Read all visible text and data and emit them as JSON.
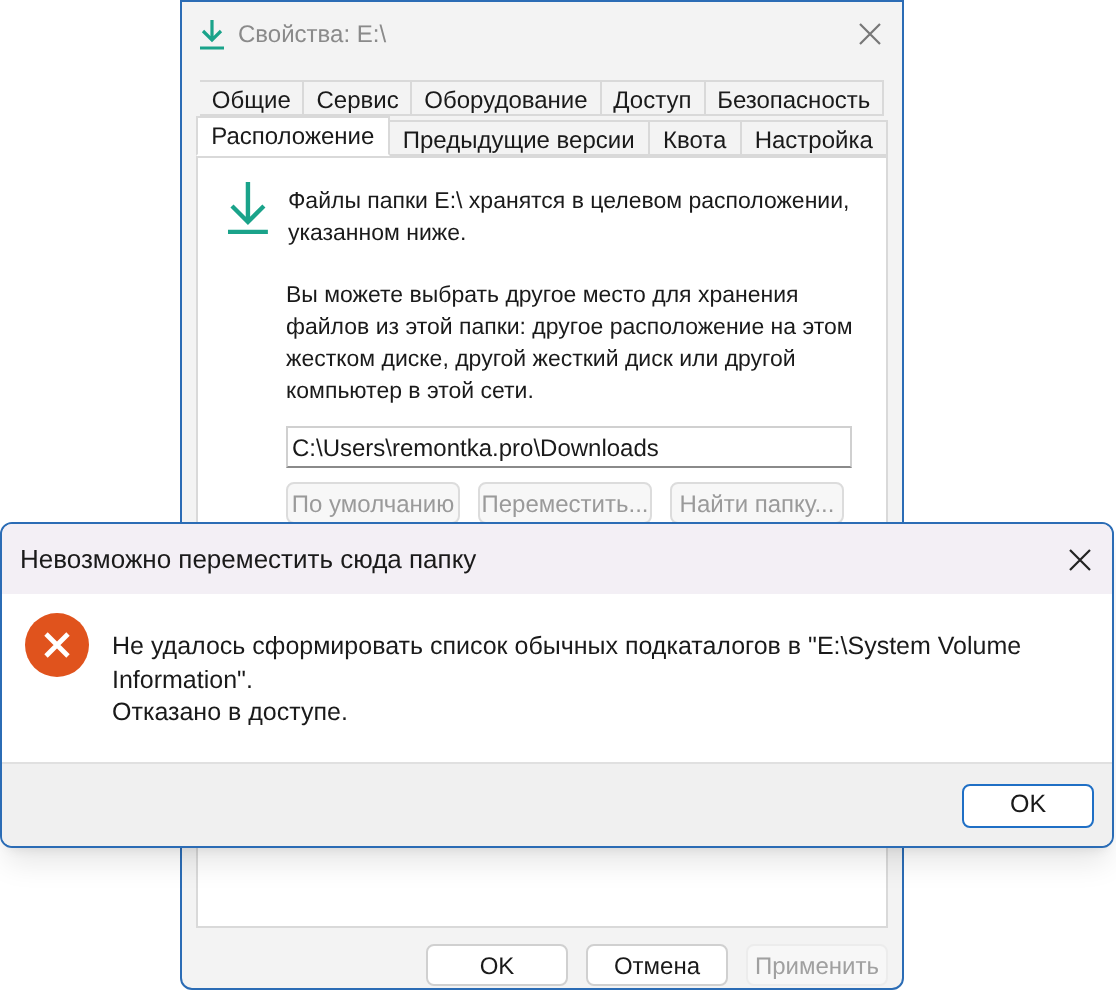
{
  "properties_window": {
    "title": "Свойства: E:\\",
    "active": false,
    "tab_rows": [
      [
        {
          "label": "Общие",
          "selected": false
        },
        {
          "label": "Сервис",
          "selected": false
        },
        {
          "label": "Оборудование",
          "selected": false
        },
        {
          "label": "Доступ",
          "selected": false
        },
        {
          "label": "Безопасность",
          "selected": false
        }
      ],
      [
        {
          "label": "Расположение",
          "selected": true
        },
        {
          "label": "Предыдущие версии",
          "selected": false
        },
        {
          "label": "Квота",
          "selected": false
        },
        {
          "label": "Настройка",
          "selected": false
        }
      ]
    ],
    "info_text": "Файлы папки E:\\ хранятся в целевом расположении, указанном ниже.",
    "description": "Вы можете выбрать другое место для хранения файлов из этой папки: другое расположение на этом жестком диске, другой жесткий диск или другой компьютер в этой сети.",
    "path_value": "C:\\Users\\remontka.pro\\Downloads",
    "location_buttons": [
      "По умолчанию",
      "Переместить...",
      "Найти папку..."
    ],
    "buttons": [
      {
        "label": "OK",
        "disabled": false
      },
      {
        "label": "Отмена",
        "disabled": false
      },
      {
        "label": "Применить",
        "disabled": true
      }
    ]
  },
  "error_dialog": {
    "title": "Невозможно переместить сюда папку",
    "message_lines": [
      "Не удалось сформировать список обычных подкаталогов в \"E:\\System Volume Information\".",
      "Отказано в доступе."
    ],
    "button": "OK"
  }
}
